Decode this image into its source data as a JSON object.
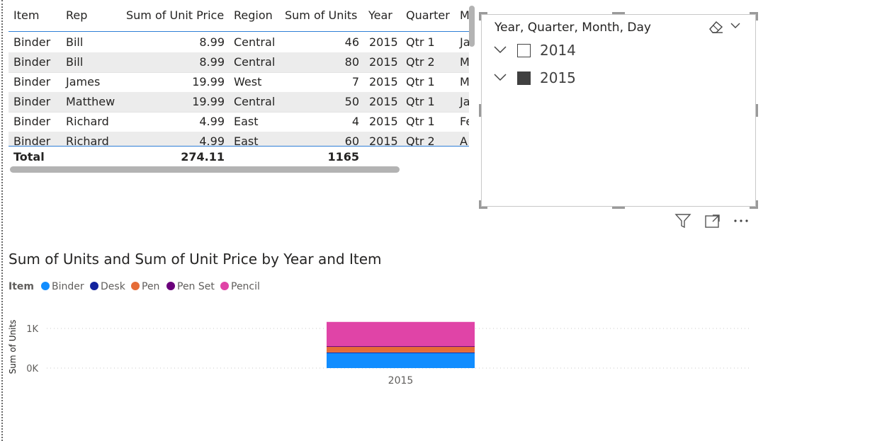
{
  "table": {
    "columns": [
      "Item",
      "Rep",
      "Sum of Unit Price",
      "Region",
      "Sum of Units",
      "Year",
      "Quarter",
      "M"
    ],
    "rows": [
      [
        "Binder",
        "Bill",
        "8.99",
        "Central",
        "46",
        "2015",
        "Qtr 1",
        "Ja"
      ],
      [
        "Binder",
        "Bill",
        "8.99",
        "Central",
        "80",
        "2015",
        "Qtr 2",
        "M"
      ],
      [
        "Binder",
        "James",
        "19.99",
        "West",
        "7",
        "2015",
        "Qtr 1",
        "M"
      ],
      [
        "Binder",
        "Matthew",
        "19.99",
        "Central",
        "50",
        "2015",
        "Qtr 1",
        "Ja"
      ],
      [
        "Binder",
        "Richard",
        "4.99",
        "East",
        "4",
        "2015",
        "Qtr 1",
        "Fe"
      ],
      [
        "Binder",
        "Richard",
        "4.99",
        "East",
        "60",
        "2015",
        "Qtr 2",
        "A"
      ]
    ],
    "total": {
      "label": "Total",
      "unit_price": "274.11",
      "units": "1165"
    }
  },
  "slicer": {
    "title": "Year, Quarter, Month, Day",
    "items": [
      {
        "label": "2014",
        "checked": false
      },
      {
        "label": "2015",
        "checked": true
      }
    ]
  },
  "visual_header": {
    "icons": [
      "filter-icon",
      "focus-mode-icon",
      "more-options-icon"
    ]
  },
  "chart": {
    "title": "Sum of Units and Sum of Unit Price by Year and Item",
    "legend_title": "Item",
    "legend": [
      {
        "name": "Binder",
        "color": "#118DFF"
      },
      {
        "name": "Desk",
        "color": "#12239E"
      },
      {
        "name": "Pen",
        "color": "#E66C37"
      },
      {
        "name": "Pen Set",
        "color": "#6B007B"
      },
      {
        "name": "Pencil",
        "color": "#E044A7"
      }
    ]
  },
  "chart_data": {
    "type": "bar",
    "stacked": true,
    "categories": [
      "2015"
    ],
    "series": [
      {
        "name": "Binder",
        "values": [
          392
        ]
      },
      {
        "name": "Desk",
        "values": [
          3
        ]
      },
      {
        "name": "Pen",
        "values": [
          150
        ]
      },
      {
        "name": "Pen Set",
        "values": [
          8
        ]
      },
      {
        "name": "Pencil",
        "values": [
          612
        ]
      }
    ],
    "xlabel": "",
    "ylabel": "Sum of Units",
    "yticks": [
      "0K",
      "1K"
    ],
    "ylim": [
      0,
      1200
    ],
    "grid": true,
    "legend_position": "top-left"
  }
}
